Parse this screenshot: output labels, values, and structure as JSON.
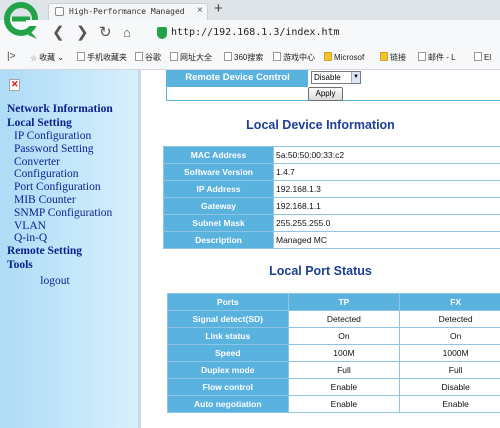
{
  "browser": {
    "tab_title": "High-Performance Managed Medi",
    "close_glyph": "×",
    "new_tab_glyph": "+",
    "url": "http://192.168.1.3/index.htm",
    "bookmarks": [
      {
        "label": "收藏",
        "icon": "star-icon"
      },
      {
        "label": "手机收藏夹",
        "icon": "page-icon"
      },
      {
        "label": "谷歌",
        "icon": "page-icon"
      },
      {
        "label": "网址大全",
        "icon": "page-icon"
      },
      {
        "label": "360搜索",
        "icon": "page-icon"
      },
      {
        "label": "游戏中心",
        "icon": "page-icon"
      },
      {
        "label": "Microsof",
        "icon": "folder-icon"
      },
      {
        "label": "链接",
        "icon": "folder-icon"
      },
      {
        "label": "邮件 - L",
        "icon": "page-icon"
      },
      {
        "label": "El",
        "icon": "page-icon"
      }
    ],
    "accent": "#22a34a"
  },
  "sidebar": {
    "broken_image_glyph": "✕",
    "sections": [
      {
        "label": "Network Information",
        "items": []
      },
      {
        "label": "Local Setting",
        "items": [
          "IP Configuration",
          "Password Setting",
          "Converter",
          "Configuration",
          "Port Configuration",
          "MIB Counter",
          "SNMP Configuration",
          "VLAN",
          "Q-in-Q"
        ]
      },
      {
        "label": "Remote Setting",
        "items": []
      },
      {
        "label": "Tools",
        "items": []
      }
    ],
    "logout": "logout",
    "text_color": "#0a1f8f"
  },
  "remote_control": {
    "label": "Remote Device Control",
    "select_value": "Disable",
    "apply_label": "Apply"
  },
  "device_info": {
    "title": "Local Device Information",
    "rows": [
      {
        "key": "MAC Address",
        "value": "5a:50:50:00:33:c2"
      },
      {
        "key": "Software Version",
        "value": "1.4.7"
      },
      {
        "key": "IP Address",
        "value": "192.168.1.3"
      },
      {
        "key": "Gateway",
        "value": "192.168.1.1"
      },
      {
        "key": "Subnet Mask",
        "value": "255.255.255.0"
      },
      {
        "key": "Description",
        "value": "Managed MC"
      }
    ]
  },
  "port_status": {
    "title": "Local Port Status",
    "headers": [
      "Ports",
      "TP",
      "FX"
    ],
    "rows": [
      {
        "key": "Signal detect(SD)",
        "tp": "Detected",
        "fx": "Detected"
      },
      {
        "key": "Link status",
        "tp": "On",
        "fx": "On"
      },
      {
        "key": "Speed",
        "tp": "100M",
        "fx": "1000M"
      },
      {
        "key": "Duplex mode",
        "tp": "Full",
        "fx": "Full"
      },
      {
        "key": "Flow control",
        "tp": "Enable",
        "fx": "Disable"
      },
      {
        "key": "Auto negotiation",
        "tp": "Enable",
        "fx": "Enable"
      }
    ]
  },
  "colors": {
    "header_cell": "#5ab2df",
    "title": "#1c3f94"
  }
}
